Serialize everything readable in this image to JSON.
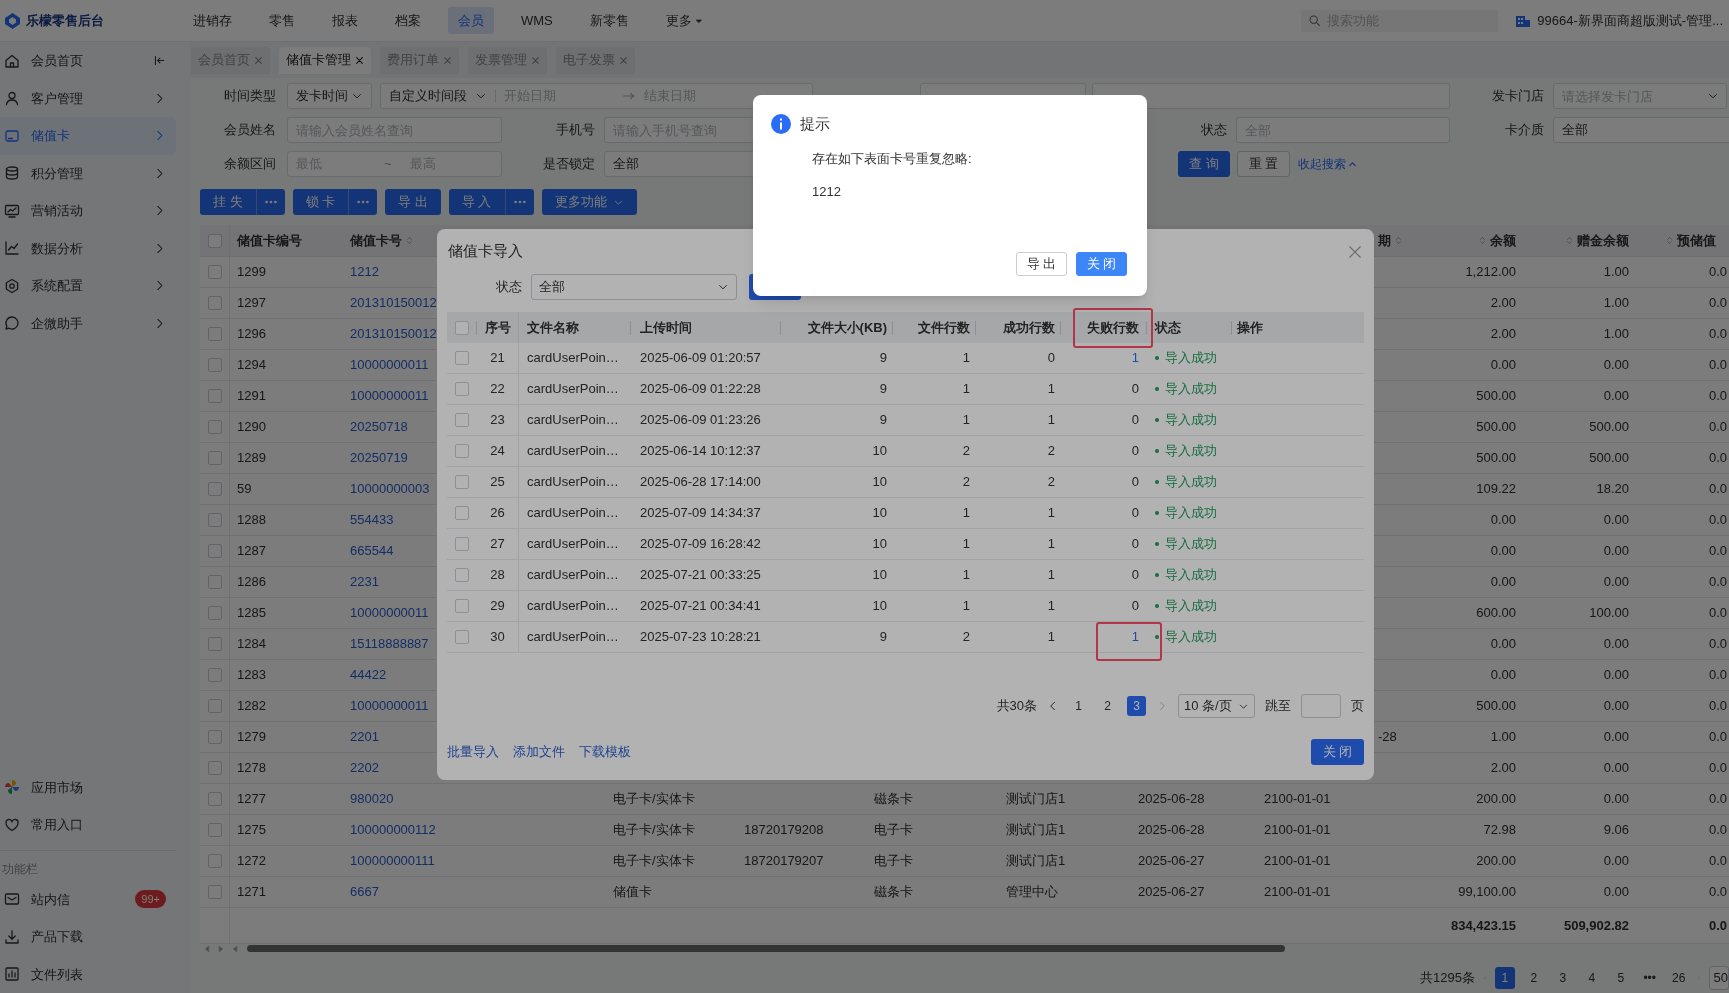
{
  "top_bar": {
    "logo": "乐檬零售后台",
    "nav": [
      {
        "label": "进销存",
        "selected": false,
        "caret": false
      },
      {
        "label": "零售",
        "selected": false,
        "caret": false
      },
      {
        "label": "报表",
        "selected": false,
        "caret": false
      },
      {
        "label": "档案",
        "selected": false,
        "caret": false
      },
      {
        "label": "会员",
        "selected": true,
        "caret": false
      },
      {
        "label": "WMS",
        "selected": false,
        "caret": false
      },
      {
        "label": "新零售",
        "selected": false,
        "caret": false
      },
      {
        "label": "更多",
        "selected": false,
        "caret": true
      }
    ],
    "search": {
      "placeholder": "搜索功能"
    },
    "store": "99664-新界面商超版测试-管理..."
  },
  "sidebar": {
    "menu": [
      {
        "label": "会员首页",
        "selected": false
      },
      {
        "label": "客户管理",
        "selected": false
      },
      {
        "label": "储值卡",
        "selected": true
      },
      {
        "label": "积分管理",
        "selected": false
      },
      {
        "label": "营销活动",
        "selected": false
      },
      {
        "label": "数据分析",
        "selected": false
      },
      {
        "label": "系统配置",
        "selected": false
      },
      {
        "label": "企微助手",
        "selected": false
      }
    ],
    "shortcuts": [
      {
        "label": "应用市场"
      },
      {
        "label": "常用入口"
      }
    ],
    "section_title": "功能栏",
    "tools": [
      {
        "label": "站内信",
        "badge": "99+"
      },
      {
        "label": "产品下载"
      },
      {
        "label": "文件列表"
      }
    ]
  },
  "tabs": [
    {
      "label": "会员首页",
      "selected": false
    },
    {
      "label": "储值卡管理",
      "selected": true
    },
    {
      "label": "费用订单",
      "selected": false
    },
    {
      "label": "发票管理",
      "selected": false
    },
    {
      "label": "电子发票",
      "selected": false
    }
  ],
  "filters": {
    "time_type": {
      "label": "时间类型",
      "value": "发卡时间"
    },
    "time_range": {
      "value": "自定义时间段",
      "start_placeholder": "开始日期",
      "end_placeholder": "结束日期"
    },
    "issue_store": {
      "label": "发卡门店",
      "placeholder": "请选择发卡门店"
    },
    "member_name": {
      "label": "会员姓名",
      "placeholder": "请输入会员姓名查询"
    },
    "phone": {
      "label": "手机号",
      "placeholder": "请输入手机号查询"
    },
    "status": {
      "label": "状态",
      "placeholder": "全部"
    },
    "card_medium": {
      "label": "卡介质",
      "value": "全部"
    },
    "balance_range": {
      "label": "余额区间",
      "min_placeholder": "最低",
      "separator": "~",
      "max_placeholder": "最高"
    },
    "locked": {
      "label": "是否锁定",
      "value": "全部"
    },
    "query_button": "查 询",
    "reset_button": "重 置",
    "collapse_link": "收起搜索"
  },
  "toolbar": [
    {
      "label": "挂 失",
      "more": true,
      "caret": false
    },
    {
      "label": "锁 卡",
      "more": true,
      "caret": false
    },
    {
      "label": "导 出",
      "more": false,
      "caret": false
    },
    {
      "label": "导 入",
      "more": true,
      "caret": false
    },
    {
      "label": "更多功能",
      "more": false,
      "caret": true
    }
  ],
  "table": {
    "select_all": {
      "checked": false
    },
    "columns": [
      {
        "label": "储值卡编号",
        "sortable": false
      },
      {
        "label": "储值卡号",
        "sortable": true
      },
      null,
      null,
      null,
      null,
      null,
      null,
      {
        "label": "期",
        "sortable": true
      },
      {
        "label": "余额",
        "sortable": true
      },
      {
        "label": "赠金余额",
        "sortable": true
      },
      {
        "label": "预储值",
        "sortable": true
      }
    ],
    "rows": [
      {
        "checked": false,
        "cells": [
          "1299",
          "1212",
          null,
          null,
          null,
          null,
          null,
          null,
          null,
          "1,212.00",
          "1.00",
          "0.0"
        ]
      },
      {
        "checked": false,
        "cells": [
          "1297",
          "201310150012",
          null,
          null,
          null,
          null,
          null,
          null,
          null,
          "2.00",
          "1.00",
          "0.0"
        ]
      },
      {
        "checked": false,
        "cells": [
          "1296",
          "201310150012",
          null,
          null,
          null,
          null,
          null,
          null,
          null,
          "2.00",
          "1.00",
          "0.0"
        ]
      },
      {
        "checked": false,
        "cells": [
          "1294",
          "10000000011",
          null,
          null,
          null,
          null,
          null,
          null,
          null,
          "0.00",
          "0.00",
          "0.0"
        ]
      },
      {
        "checked": false,
        "cells": [
          "1291",
          "10000000011",
          null,
          null,
          null,
          null,
          null,
          null,
          null,
          "500.00",
          "0.00",
          "0.0"
        ]
      },
      {
        "checked": false,
        "cells": [
          "1290",
          "20250718",
          null,
          null,
          null,
          null,
          null,
          null,
          null,
          "500.00",
          "500.00",
          "0.0"
        ]
      },
      {
        "checked": false,
        "cells": [
          "1289",
          "20250719",
          null,
          null,
          null,
          null,
          null,
          null,
          null,
          "500.00",
          "500.00",
          "0.0"
        ]
      },
      {
        "checked": false,
        "cells": [
          "59",
          "10000000003",
          null,
          null,
          null,
          null,
          null,
          null,
          null,
          "109.22",
          "18.20",
          "0.0"
        ]
      },
      {
        "checked": false,
        "cells": [
          "1288",
          "554433",
          null,
          null,
          null,
          null,
          null,
          null,
          null,
          "0.00",
          "0.00",
          "0.0"
        ]
      },
      {
        "checked": false,
        "cells": [
          "1287",
          "665544",
          null,
          null,
          null,
          null,
          null,
          null,
          null,
          "0.00",
          "0.00",
          "0.0"
        ]
      },
      {
        "checked": false,
        "cells": [
          "1286",
          "2231",
          null,
          null,
          null,
          null,
          null,
          null,
          null,
          "0.00",
          "0.00",
          "0.0"
        ]
      },
      {
        "checked": false,
        "cells": [
          "1285",
          "10000000011",
          null,
          null,
          null,
          null,
          null,
          null,
          null,
          "600.00",
          "100.00",
          "0.0"
        ]
      },
      {
        "checked": false,
        "cells": [
          "1284",
          "15118888887",
          null,
          null,
          null,
          null,
          null,
          null,
          null,
          "0.00",
          "0.00",
          "0.0"
        ]
      },
      {
        "checked": false,
        "cells": [
          "1283",
          "44422",
          null,
          null,
          null,
          null,
          null,
          null,
          null,
          "0.00",
          "0.00",
          "0.0"
        ]
      },
      {
        "checked": false,
        "cells": [
          "1282",
          "10000000011",
          null,
          null,
          null,
          null,
          null,
          null,
          null,
          "500.00",
          "0.00",
          "0.0"
        ]
      },
      {
        "checked": false,
        "cells": [
          "1279",
          "2201",
          null,
          null,
          null,
          null,
          null,
          null,
          "-28",
          "1.00",
          "0.00",
          "0.0"
        ]
      },
      {
        "checked": false,
        "cells": [
          "1278",
          "2202",
          null,
          null,
          null,
          null,
          null,
          null,
          null,
          "2.00",
          "0.00",
          "0.0"
        ]
      },
      {
        "checked": false,
        "cells": [
          "1277",
          "980020",
          "电子卡/实体卡",
          null,
          "磁条卡",
          "测试门店1",
          "2025-06-28",
          "2100-01-01",
          null,
          "200.00",
          "0.00",
          "0.0"
        ]
      },
      {
        "checked": false,
        "cells": [
          "1275",
          "100000000112",
          "电子卡/实体卡",
          "18720179208",
          "电子卡",
          "测试门店1",
          "2025-06-28",
          "2100-01-01",
          null,
          "72.98",
          "9.06",
          "0.0"
        ]
      },
      {
        "checked": false,
        "cells": [
          "1272",
          "100000000111",
          "电子卡/实体卡",
          "18720179207",
          "电子卡",
          "测试门店1",
          "2025-06-27",
          "2100-01-01",
          null,
          "200.00",
          "0.00",
          "0.0"
        ]
      },
      {
        "checked": false,
        "cells": [
          "1271",
          "6667",
          "储值卡",
          null,
          "磁条卡",
          "管理中心",
          "2025-06-27",
          "2100-01-01",
          null,
          "99,100.00",
          "0.00",
          "0.0"
        ]
      }
    ],
    "totals": {
      "balance": "834,423.15",
      "bonus": "509,902.82",
      "prestore": "0.0"
    },
    "pagination": {
      "total": "共1295条",
      "pages": [
        {
          "label": "1",
          "selected": true
        },
        {
          "label": "2",
          "selected": false
        },
        {
          "label": "3",
          "selected": false
        },
        {
          "label": "4",
          "selected": false
        },
        {
          "label": "5",
          "selected": false
        },
        {
          "label": "•••",
          "selected": false
        },
        {
          "label": "26",
          "selected": false
        }
      ],
      "page_size": "50"
    }
  },
  "import_dialog": {
    "title": "储值卡导入",
    "status_filter": {
      "label": "状态",
      "value": "全部"
    },
    "select_all": {
      "checked": false
    },
    "columns": [
      {
        "label": "序号",
        "highlighted": false
      },
      {
        "label": "文件名称",
        "highlighted": false
      },
      {
        "label": "上传时间",
        "highlighted": false
      },
      {
        "label": "文件大小(KB)",
        "highlighted": false
      },
      {
        "label": "文件行数",
        "highlighted": false
      },
      {
        "label": "成功行数",
        "highlighted": false
      },
      {
        "label": "失败行数",
        "highlighted": true
      },
      {
        "label": "状态",
        "highlighted": false
      },
      {
        "label": "操作",
        "highlighted": false
      }
    ],
    "rows": [
      {
        "checked": false,
        "index": "21",
        "file": "cardUserPoin…",
        "time": "2025-06-09 01:20:57",
        "size": "9",
        "rows": "1",
        "success": "0",
        "failed": {
          "text": "1",
          "link": true,
          "highlighted": false
        },
        "status": {
          "text": "导入成功",
          "kind": "success"
        }
      },
      {
        "checked": false,
        "index": "22",
        "file": "cardUserPoin…",
        "time": "2025-06-09 01:22:28",
        "size": "9",
        "rows": "1",
        "success": "1",
        "failed": {
          "text": "0",
          "link": false,
          "highlighted": false
        },
        "status": {
          "text": "导入成功",
          "kind": "success"
        }
      },
      {
        "checked": false,
        "index": "23",
        "file": "cardUserPoin…",
        "time": "2025-06-09 01:23:26",
        "size": "9",
        "rows": "1",
        "success": "1",
        "failed": {
          "text": "0",
          "link": false,
          "highlighted": false
        },
        "status": {
          "text": "导入成功",
          "kind": "success"
        }
      },
      {
        "checked": false,
        "index": "24",
        "file": "cardUserPoin…",
        "time": "2025-06-14 10:12:37",
        "size": "10",
        "rows": "2",
        "success": "2",
        "failed": {
          "text": "0",
          "link": false,
          "highlighted": false
        },
        "status": {
          "text": "导入成功",
          "kind": "success"
        }
      },
      {
        "checked": false,
        "index": "25",
        "file": "cardUserPoin…",
        "time": "2025-06-28 17:14:00",
        "size": "10",
        "rows": "2",
        "success": "2",
        "failed": {
          "text": "0",
          "link": false,
          "highlighted": false
        },
        "status": {
          "text": "导入成功",
          "kind": "success"
        }
      },
      {
        "checked": false,
        "index": "26",
        "file": "cardUserPoin…",
        "time": "2025-07-09 14:34:37",
        "size": "10",
        "rows": "1",
        "success": "1",
        "failed": {
          "text": "0",
          "link": false,
          "highlighted": false
        },
        "status": {
          "text": "导入成功",
          "kind": "success"
        }
      },
      {
        "checked": false,
        "index": "27",
        "file": "cardUserPoin…",
        "time": "2025-07-09 16:28:42",
        "size": "10",
        "rows": "1",
        "success": "1",
        "failed": {
          "text": "0",
          "link": false,
          "highlighted": false
        },
        "status": {
          "text": "导入成功",
          "kind": "success"
        }
      },
      {
        "checked": false,
        "index": "28",
        "file": "cardUserPoin…",
        "time": "2025-07-21 00:33:25",
        "size": "10",
        "rows": "1",
        "success": "1",
        "failed": {
          "text": "0",
          "link": false,
          "highlighted": false
        },
        "status": {
          "text": "导入成功",
          "kind": "success"
        }
      },
      {
        "checked": false,
        "index": "29",
        "file": "cardUserPoin…",
        "time": "2025-07-21 00:34:41",
        "size": "10",
        "rows": "1",
        "success": "1",
        "failed": {
          "text": "0",
          "link": false,
          "highlighted": false
        },
        "status": {
          "text": "导入成功",
          "kind": "success"
        }
      },
      {
        "checked": false,
        "index": "30",
        "file": "cardUserPoin…",
        "time": "2025-07-23 10:28:21",
        "size": "9",
        "rows": "2",
        "success": "1",
        "failed": {
          "text": "1",
          "link": true,
          "highlighted": true
        },
        "status": {
          "text": "导入成功",
          "kind": "success"
        }
      }
    ],
    "pagination": {
      "total": "共30条",
      "pages": [
        {
          "label": "1",
          "selected": false
        },
        {
          "label": "2",
          "selected": false
        },
        {
          "label": "3",
          "selected": true
        }
      ],
      "page_size": "10 条/页",
      "jump_label": "跳至",
      "page_suffix": "页"
    },
    "footer_links": [
      "批量导入",
      "添加文件",
      "下载模板"
    ],
    "close_button": "关 闭"
  },
  "alert": {
    "title": "提示",
    "message": "存在如下表面卡号重复忽略:",
    "items": [
      "1212"
    ],
    "buttons": [
      {
        "label": "导 出",
        "kind": "default"
      },
      {
        "label": "关 闭",
        "kind": "primary"
      }
    ]
  }
}
